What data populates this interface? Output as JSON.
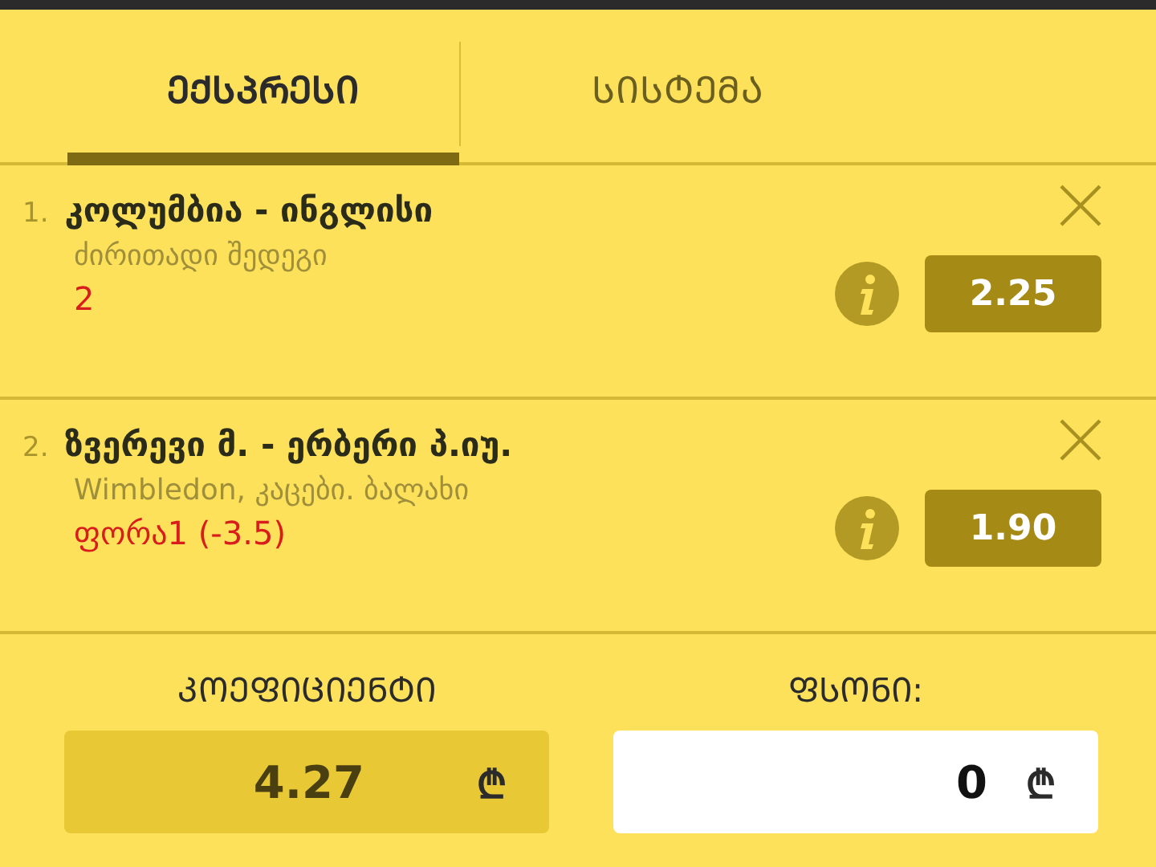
{
  "tabs": [
    {
      "label": "ᲔᲥᲡᲞᲠᲔᲡᲘ",
      "selected": true
    },
    {
      "label": "ᲡᲘᲡᲢᲔᲛᲐ",
      "selected": false
    }
  ],
  "bets": [
    {
      "number": "1.",
      "match": "კოლუმბია - ინგლისი",
      "market": "ძირითადი შედეგი",
      "pick": "2",
      "odds": "2.25"
    },
    {
      "number": "2.",
      "match": "ზვერევი მ. - ერბერი პ.იუ.",
      "market": "Wimbledon, კაცები. ბალახი",
      "pick": "ფორა1 (-3.5)",
      "odds": "1.90"
    }
  ],
  "summary": {
    "odds_label": "ᲙᲝᲔᲤᲘᲪᲘᲔᲜᲢᲘ",
    "odds_value": "4.27",
    "stake_label": "ᲤᲡᲝᲜᲘ:",
    "stake_value": "0",
    "currency": "₾"
  }
}
